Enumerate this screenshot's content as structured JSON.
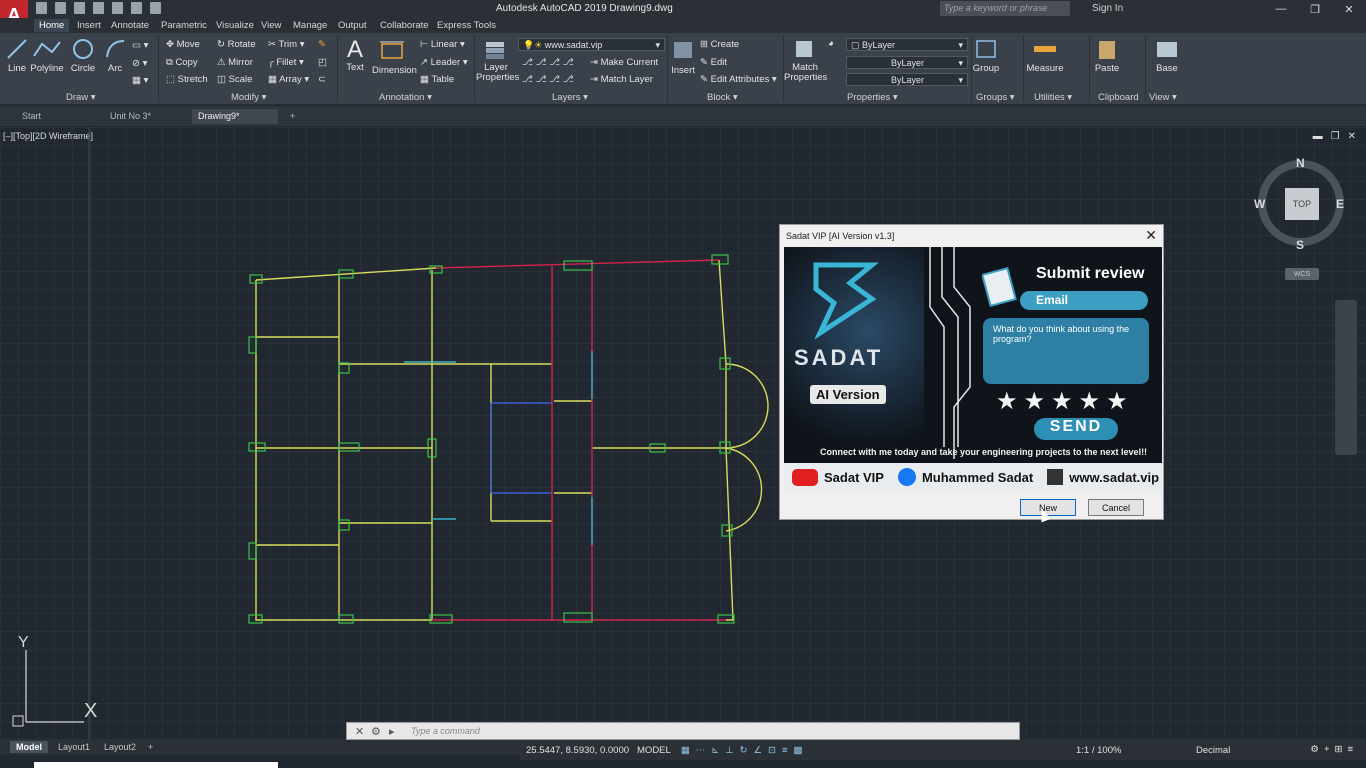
{
  "titlebar": {
    "app_icon_letter": "A",
    "title": "Autodesk AutoCAD 2019    Drawing9.dwg",
    "search_placeholder": "Type a keyword or phrase",
    "signin": "Sign In",
    "minimize": "—",
    "maximize": "❐",
    "close": "✕"
  },
  "ribbon_tabs": [
    "Home",
    "Insert",
    "Annotate",
    "Parametric",
    "Visualize",
    "View",
    "Manage",
    "Output",
    "Collaborate",
    "Express Tools"
  ],
  "ribbon": {
    "draw": {
      "line": "Line",
      "polyline": "Polyline",
      "circle": "Circle",
      "arc": "Arc",
      "title": "Draw ▾"
    },
    "modify": {
      "move": "Move",
      "rotate": "Rotate",
      "trim": "Trim ▾",
      "copy": "Copy",
      "mirror": "Mirror",
      "fillet": "Fillet ▾",
      "stretch": "Stretch",
      "scale": "Scale",
      "array": "Array ▾",
      "title": "Modify ▾"
    },
    "annotation": {
      "text": "Text",
      "dimension": "Dimension",
      "linear": "Linear ▾",
      "leader": "Leader ▾",
      "table": "Table",
      "title": "Annotation ▾"
    },
    "layers": {
      "layer_properties": "Layer Properties",
      "layer_combo": "www.sadat.vip",
      "make_current": "Make Current",
      "match_layer": "Match Layer",
      "title": "Layers ▾"
    },
    "block": {
      "insert": "Insert",
      "create": "Create",
      "edit": "Edit",
      "edit_attributes": "Edit Attributes ▾",
      "title": "Block ▾"
    },
    "properties": {
      "match_properties": "Match Properties",
      "color": "ByLayer",
      "linetype": "ByLayer",
      "lineweight": "ByLayer",
      "title": "Properties ▾"
    },
    "groups": {
      "group": "Group",
      "title": "Groups ▾"
    },
    "utilities": {
      "measure": "Measure",
      "title": "Utilities ▾"
    },
    "clipboard": {
      "paste": "Paste",
      "title": "Clipboard"
    },
    "view": {
      "base": "Base",
      "title": "View ▾"
    }
  },
  "file_tabs": [
    "Start",
    "Unit No 3*",
    "Drawing9*"
  ],
  "viewport": {
    "label": "[–][Top][2D Wireframe]"
  },
  "viewcube": {
    "top": "TOP",
    "n": "N",
    "s": "S",
    "e": "E",
    "w": "W",
    "wcs": "WCS"
  },
  "ucs": {
    "x": "X",
    "y": "Y"
  },
  "dialog": {
    "title": "Sadat VIP [AI Version v1.3]",
    "close": "✕",
    "brand": "SADAT",
    "ai_version": "AI Version",
    "submit_review": "Submit review",
    "email": "Email",
    "question": "What do you think about using the program?",
    "stars": "★★★★★",
    "send": "SEND",
    "connect": "Connect with me today and take your engineering projects to the next level!!",
    "youtube": "Sadat VIP",
    "facebook": "Muhammed Sadat",
    "website": "www.sadat.vip",
    "new_button": "New",
    "cancel_button": "Cancel"
  },
  "command_line": {
    "placeholder": "Type a command"
  },
  "layout_tabs": [
    "Model",
    "Layout1",
    "Layout2"
  ],
  "status": {
    "coords": "25.5447, 8.5930, 0.0000",
    "model": "MODEL",
    "scale": "1:1 / 100%",
    "units": "Decimal"
  },
  "colors": {
    "accent": "#3b9ec2",
    "autocad_red": "#c1272d",
    "yellow_walls": "#d8dc5a",
    "red_walls": "#d0244a",
    "green_columns": "#3ac24a"
  }
}
